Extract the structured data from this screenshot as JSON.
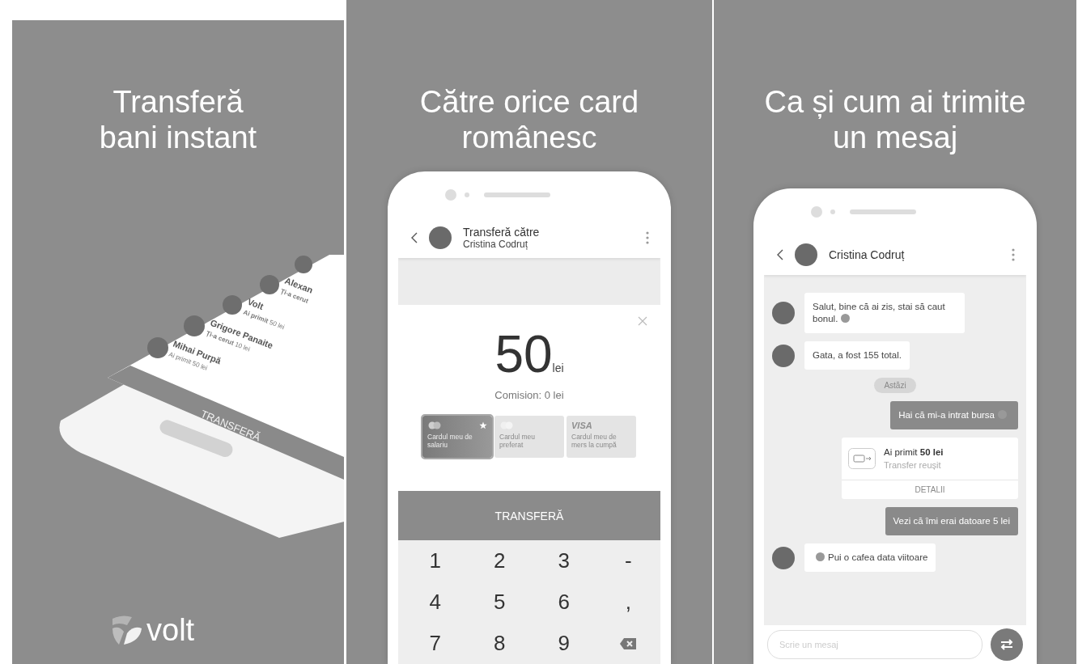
{
  "panel_intro": {
    "headline_lines": [
      "Transferă",
      "bani instant"
    ],
    "phone": {
      "contacts": [
        {
          "name": "Mihai Purpă",
          "status": "Ai primit 50 lei"
        },
        {
          "name": "Grigore Panaite",
          "status": "**Ți-a cerut** 10 lei"
        },
        {
          "name": "Volt",
          "status": "**Ai primit** 50 lei"
        },
        {
          "name": "Alexan",
          "status": "**Ți-a cerut**"
        }
      ],
      "button": "TRANSFERĂ"
    },
    "logo": "volt"
  },
  "panel_transfer": {
    "headline_lines": [
      "Către orice card",
      "românesc"
    ],
    "header": {
      "title": "Transferă către",
      "subtitle": "Cristina Codruț"
    },
    "amount": "50",
    "currency": "lei",
    "commission": "Comision: 0 lei",
    "cards": [
      {
        "kind": "mastercard",
        "label": "Cardul meu de salariu",
        "selected": true,
        "favorite": true
      },
      {
        "kind": "mastercard",
        "label": "Cardul meu preferat",
        "selected": false,
        "favorite": false
      },
      {
        "kind": "visa",
        "brand_text": "VISA",
        "label": "Cardul meu de mers la cumpă",
        "selected": false,
        "favorite": false
      }
    ],
    "button": "TRANSFERĂ",
    "keys": [
      {
        "kind": "char",
        "label": "1"
      },
      {
        "kind": "char",
        "label": "2"
      },
      {
        "kind": "char",
        "label": "3"
      },
      {
        "kind": "char",
        "label": "-"
      },
      {
        "kind": "char",
        "label": "4"
      },
      {
        "kind": "char",
        "label": "5"
      },
      {
        "kind": "char",
        "label": "6"
      },
      {
        "kind": "char",
        "label": ","
      },
      {
        "kind": "char",
        "label": "7"
      },
      {
        "kind": "char",
        "label": "8"
      },
      {
        "kind": "char",
        "label": "9"
      },
      {
        "kind": "backspace"
      }
    ]
  },
  "panel_chat": {
    "headline_lines": [
      "Ca și cum ai trimite",
      "un mesaj"
    ],
    "header": {
      "title": "Cristina Codruț"
    },
    "messages": [
      {
        "kind": "incoming",
        "text": "Salut, bine că ai zis, stai să caut bonul.",
        "emoji_after": true
      },
      {
        "kind": "incoming",
        "text": "Gata, a fost 155 total."
      },
      {
        "kind": "date",
        "text": "Astăzi"
      },
      {
        "kind": "outgoing",
        "text": "Hai că mi-a intrat bursa",
        "emoji_after": true
      },
      {
        "kind": "transfer",
        "title": "Ai primit **50 lei**",
        "status": "Transfer reușit",
        "action": "DETALII"
      },
      {
        "kind": "outgoing",
        "text": "Vezi că îmi erai datoare 5 lei"
      },
      {
        "kind": "incoming",
        "text": "Pui o cafea data viitoare",
        "emoji_before": true
      }
    ],
    "input": {
      "placeholder": "Scrie un mesaj"
    }
  }
}
